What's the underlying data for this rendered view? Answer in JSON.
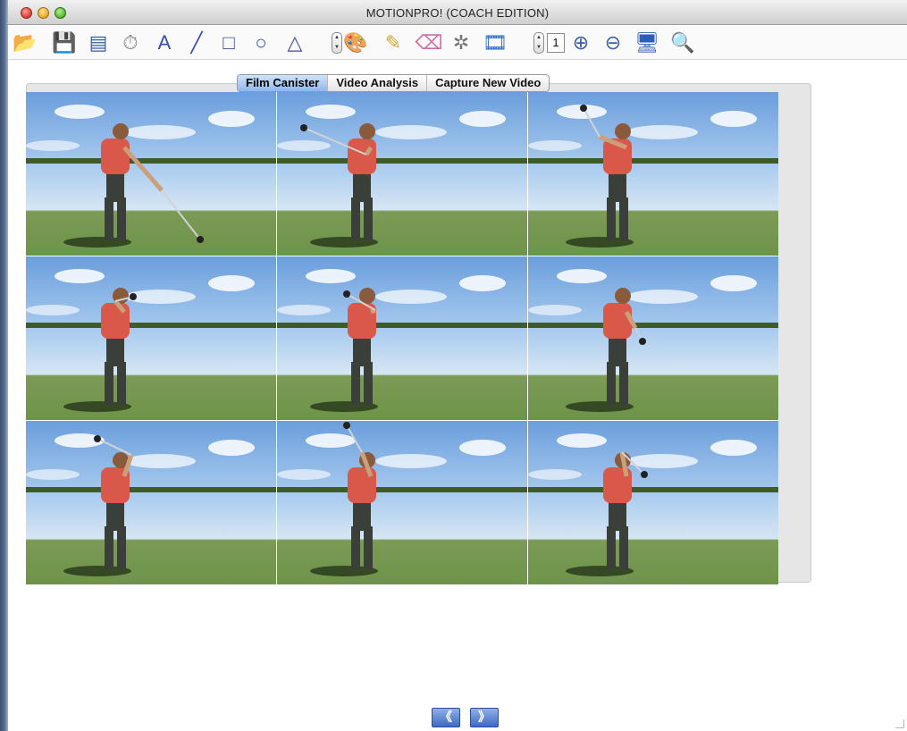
{
  "window": {
    "title": "MOTIONPRO! (COACH EDITION)"
  },
  "toolbar": {
    "tools": [
      {
        "name": "open-folder-icon",
        "glyph": "📂"
      },
      {
        "name": "save-icon",
        "glyph": "💾"
      },
      {
        "name": "filmstrip-panel-icon",
        "glyph": "▤"
      },
      {
        "name": "stopwatch-icon",
        "glyph": "⏱"
      },
      {
        "name": "text-tool-icon",
        "glyph": "A"
      },
      {
        "name": "line-tool-icon",
        "glyph": "╱"
      },
      {
        "name": "rectangle-tool-icon",
        "glyph": "□"
      },
      {
        "name": "circle-tool-icon",
        "glyph": "○"
      },
      {
        "name": "angle-tool-icon",
        "glyph": "△"
      },
      {
        "name": "color-palette-icon",
        "glyph": "🎨"
      },
      {
        "name": "pencil-icon",
        "glyph": "✎"
      },
      {
        "name": "eraser-icon",
        "glyph": "⌫"
      },
      {
        "name": "reel-icon",
        "glyph": "✲"
      },
      {
        "name": "filmstrip-icon",
        "glyph": "🎞"
      },
      {
        "name": "zoom-in-icon",
        "glyph": "⊕"
      },
      {
        "name": "zoom-out-icon",
        "glyph": "⊖"
      },
      {
        "name": "monitor-icon",
        "glyph": "🖥"
      },
      {
        "name": "search-icon",
        "glyph": "🔍"
      }
    ],
    "frame_value": "1"
  },
  "tabs": [
    {
      "label": "Film Canister",
      "active": true
    },
    {
      "label": "Video Analysis",
      "active": false
    },
    {
      "label": "Capture New Video",
      "active": false
    }
  ],
  "frames": [
    {
      "pose": "address"
    },
    {
      "pose": "takeaway"
    },
    {
      "pose": "halfway-back"
    },
    {
      "pose": "top"
    },
    {
      "pose": "downswing"
    },
    {
      "pose": "impact"
    },
    {
      "pose": "release"
    },
    {
      "pose": "follow-through"
    },
    {
      "pose": "finish"
    }
  ],
  "navigation": {
    "prev_label": "《",
    "next_label": "》"
  },
  "colors": {
    "shirt": "#d9584a",
    "pants": "#3b3f3a",
    "grass": "#6e9448",
    "sky": "#7aa9df",
    "active_tab": "#9dc2ee",
    "nav_button": "#3e69c1"
  }
}
